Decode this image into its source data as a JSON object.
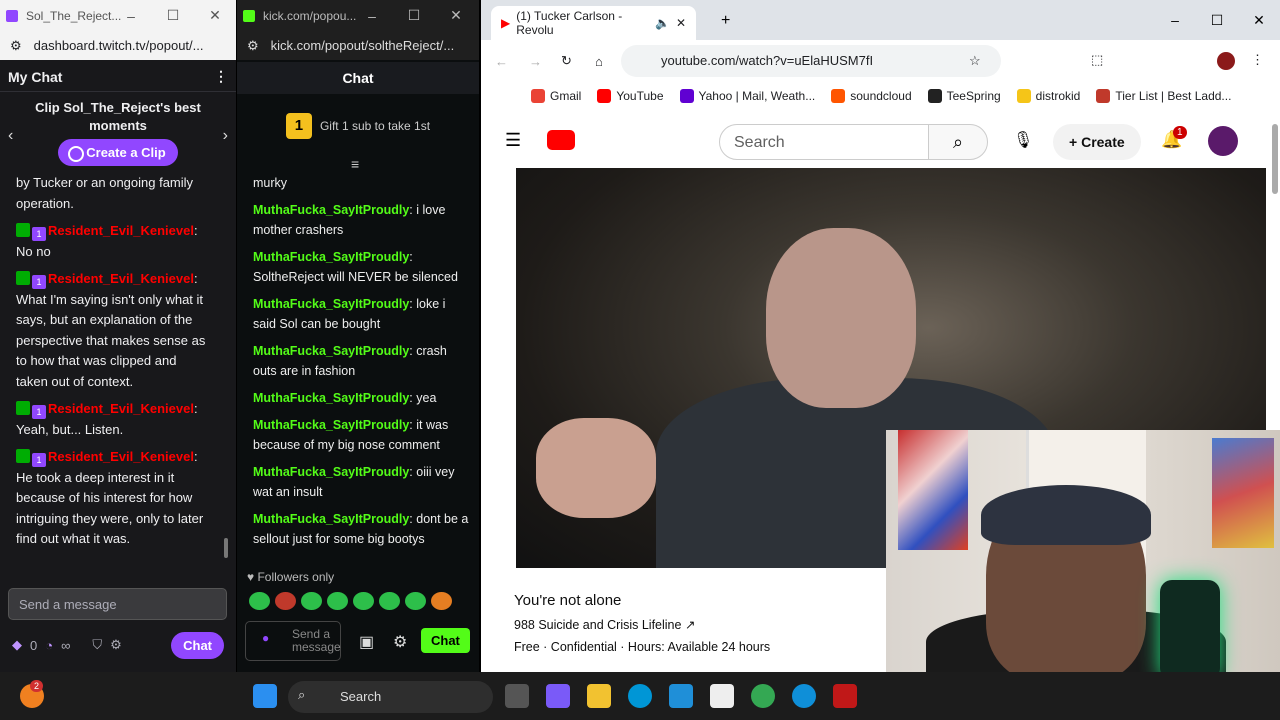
{
  "twitch": {
    "tab_title": "Sol_The_Reject...",
    "url": "dashboard.twitch.tv/popout/...",
    "header": "My Chat",
    "clip_title": "Clip Sol_The_Reject's best moments",
    "clip_button": "Create a Clip",
    "messages": [
      {
        "user": "",
        "text": "by Tucker or an ongoing family operation."
      },
      {
        "user": "Resident_Evil_Kenievel",
        "text": "No no"
      },
      {
        "user": "Resident_Evil_Kenievel",
        "text": "What I'm saying isn't only what it says, but an explanation of the perspective that makes sense as to how that was clipped and taken out of context."
      },
      {
        "user": "Resident_Evil_Kenievel",
        "text": "Yeah, but... Listen."
      },
      {
        "user": "Resident_Evil_Kenievel",
        "text": "He took a deep interest in it because of his interest for how intriguing they were, only to later find out what it was."
      }
    ],
    "input_placeholder": "Send a message",
    "points": "0",
    "infinity": "∞",
    "chat_button": "Chat"
  },
  "kick": {
    "tab_title": "kick.com/popou...",
    "url": "kick.com/popout/soltheReject/...",
    "header": "Chat",
    "gift_badge": "1",
    "gift_text": "Gift 1 sub to take 1st",
    "messages": [
      {
        "user": "",
        "text": "murky"
      },
      {
        "user": "MuthaFucka_SayItProudly",
        "text": "i love mother crashers"
      },
      {
        "user": "MuthaFucka_SayItProudly",
        "text": "SoltheReject will NEVER be silenced"
      },
      {
        "user": "MuthaFucka_SayItProudly",
        "text": "loke i said Sol can be bought"
      },
      {
        "user": "MuthaFucka_SayItProudly",
        "text": "crash outs are in fashion"
      },
      {
        "user": "MuthaFucka_SayItProudly",
        "text": "yea"
      },
      {
        "user": "MuthaFucka_SayItProudly",
        "text": "it was because of my big nose comment"
      },
      {
        "user": "MuthaFucka_SayItProudly",
        "text": "oiii vey wat an insult"
      },
      {
        "user": "MuthaFucka_SayItProudly",
        "text": "dont be a sellout just for some big bootys"
      }
    ],
    "followers_only": "Followers only",
    "input_placeholder": "Send a message",
    "chat_button": "Chat"
  },
  "youtube": {
    "tab_title": "(1) Tucker Carlson - Revolu",
    "url": "youtube.com/watch?v=uElaHUSM7fI",
    "bookmarks": [
      {
        "label": "Gmail",
        "color": "#ea4335"
      },
      {
        "label": "YouTube",
        "color": "#ff0000"
      },
      {
        "label": "Yahoo | Mail, Weath...",
        "color": "#6001d2"
      },
      {
        "label": "soundcloud",
        "color": "#ff5500"
      },
      {
        "label": "TeeSpring",
        "color": "#222222"
      },
      {
        "label": "distrokid",
        "color": "#f5c518"
      },
      {
        "label": "Tier List | Best Ladd...",
        "color": "#c0392b"
      }
    ],
    "search_placeholder": "Search",
    "create_label": "Create",
    "notification_count": "1",
    "panel_title": "You're not alone",
    "panel_link": "988 Suicide and Crisis Lifeline",
    "panel_info": "Free · Confidential · Hours: Available 24 hours"
  },
  "taskbar": {
    "search_label": "Search",
    "notify_count": "2"
  },
  "colors": {
    "twitch_purple": "#9147ff",
    "kick_green": "#53fc18",
    "youtube_red": "#ff0000"
  }
}
